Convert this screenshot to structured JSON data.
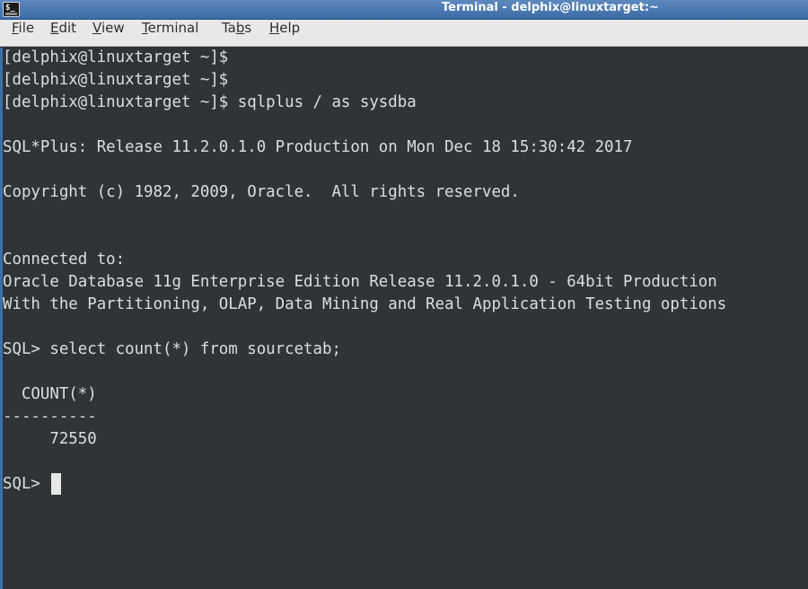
{
  "window": {
    "title": "Terminal - delphix@linuxtarget:~"
  },
  "menu": {
    "items": [
      {
        "first": "F",
        "rest": "ile"
      },
      {
        "first": "E",
        "rest": "dit"
      },
      {
        "first": "V",
        "rest": "iew"
      },
      {
        "first": "T",
        "rest": "erminal"
      },
      {
        "pre": "Ta",
        "first": "b",
        "rest": "s"
      },
      {
        "first": "H",
        "rest": "elp"
      }
    ]
  },
  "terminal": {
    "lines": [
      "[delphix@linuxtarget ~]$",
      "[delphix@linuxtarget ~]$",
      "[delphix@linuxtarget ~]$ sqlplus / as sysdba",
      "",
      "SQL*Plus: Release 11.2.0.1.0 Production on Mon Dec 18 15:30:42 2017",
      "",
      "Copyright (c) 1982, 2009, Oracle.  All rights reserved.",
      "",
      "",
      "Connected to:",
      "Oracle Database 11g Enterprise Edition Release 11.2.0.1.0 - 64bit Production",
      "With the Partitioning, OLAP, Data Mining and Real Application Testing options",
      "",
      "SQL> select count(*) from sourcetab;",
      "",
      "  COUNT(*)",
      "----------",
      "     72550",
      "",
      "SQL> "
    ]
  },
  "icons": {
    "app": "terminal-icon"
  }
}
